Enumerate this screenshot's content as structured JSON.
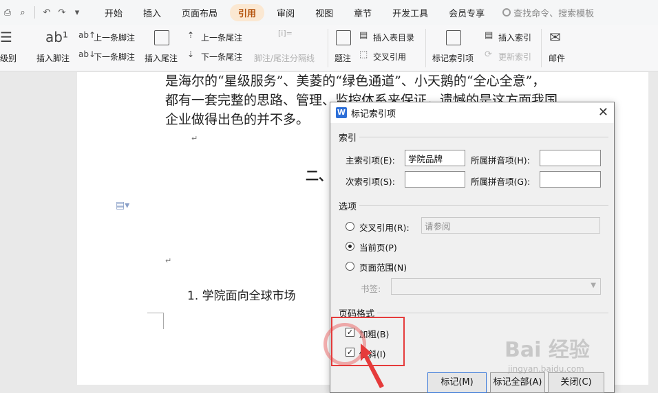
{
  "menubar": {
    "tabs": [
      "开始",
      "插入",
      "页面布局",
      "引用",
      "审阅",
      "视图",
      "章节",
      "开发工具",
      "会员专享"
    ],
    "active_tab": "引用",
    "search_placeholder": "查找命令、搜索模板"
  },
  "ribbon": {
    "level": "级别",
    "insert_footnote": "插入脚注",
    "prev_footnote": "上一条脚注",
    "next_footnote": "下一条脚注",
    "insert_endnote": "插入尾注",
    "prev_endnote": "上一条尾注",
    "next_endnote": "下一条尾注",
    "separator": "脚注/尾注分隔线",
    "caption": "题注",
    "insert_toc_table": "插入表目录",
    "cross_ref": "交叉引用",
    "mark_index": "标记索引项",
    "insert_index": "插入索引",
    "update_index": "更新索引",
    "mail": "邮件"
  },
  "document": {
    "line1": "是海尔的“星级服务”、美菱的“绿色通道”、小天鹅的“全心全意”，",
    "line2": "都有一套完整的思路、管理、监控体系来保证，遗憾的是这方面我国",
    "line3": "企业做得出色的并不多。",
    "heading_partial": "二、",
    "item": "1. 学院面向全球市场"
  },
  "dialog": {
    "title": "标记索引项",
    "section_index": "索引",
    "main_entry_label": "主索引项(E):",
    "main_entry_value": "学院品牌",
    "pinyin_h_label": "所属拼音项(H):",
    "sub_entry_label": "次索引项(S):",
    "pinyin_g_label": "所属拼音项(G):",
    "section_options": "选项",
    "cross_ref_label": "交叉引用(R):",
    "cross_ref_value": "请参阅",
    "current_page_label": "当前页(P)",
    "page_range_label": "页面范围(N)",
    "bookmark_label": "书签:",
    "section_format": "页码格式",
    "bold_label": "加粗(B)",
    "italic_label": "倾斜(I)",
    "mark_button": "标记(M)",
    "mark_all_button": "标记全部(A)",
    "close_button": "关闭(C)"
  },
  "watermark": {
    "text": "Bai 经验",
    "sub": "jingyan.baidu.com"
  }
}
